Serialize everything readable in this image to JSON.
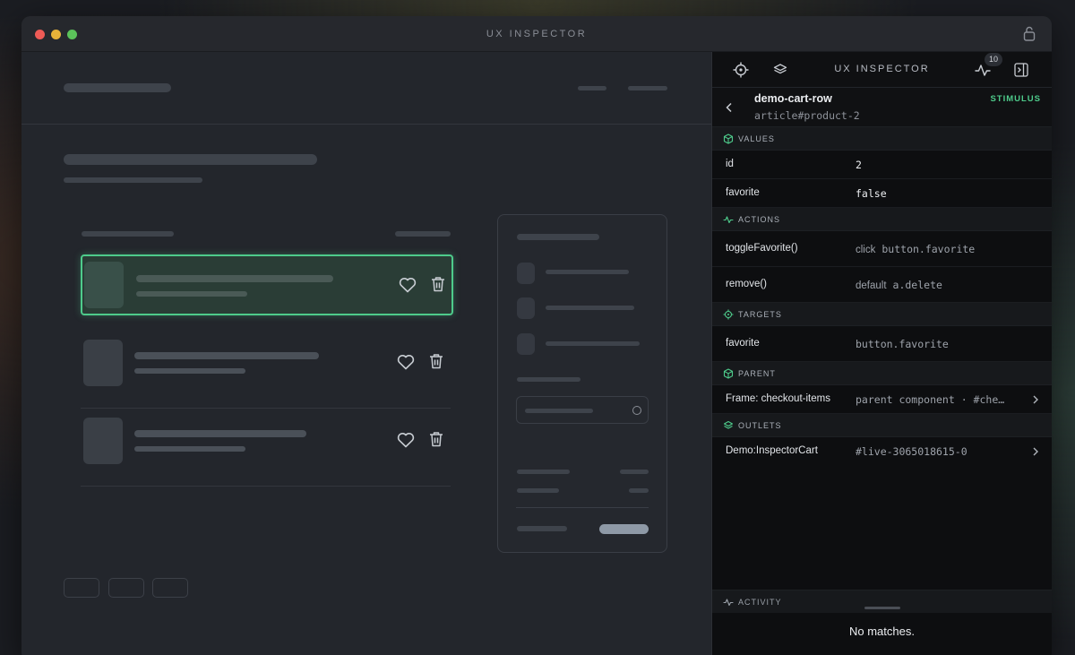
{
  "window": {
    "title": "UX INSPECTOR"
  },
  "inspector": {
    "title": "UX INSPECTOR",
    "activity_count": "10",
    "element": {
      "name": "demo-cart-row",
      "selector": "article#product-2",
      "kind": "STIMULUS"
    },
    "sections": {
      "values": "VALUES",
      "actions": "ACTIONS",
      "targets": "TARGETS",
      "parent": "PARENT",
      "outlets": "OUTLETS",
      "activity": "ACTIVITY"
    },
    "values": [
      {
        "key": "id",
        "value": "2"
      },
      {
        "key": "favorite",
        "value": "false"
      }
    ],
    "actions": [
      {
        "name": "toggleFavorite()",
        "event": "click",
        "target": "button.favorite"
      },
      {
        "name": "remove()",
        "event": "default",
        "target": "a.delete"
      }
    ],
    "targets": [
      {
        "name": "favorite",
        "value": "button.favorite"
      }
    ],
    "parent": {
      "name": "Frame: checkout-items",
      "value": "parent component · #che…"
    },
    "outlets": [
      {
        "name": "Demo:InspectorCart",
        "value": "#live-3065018615-0"
      }
    ],
    "empty_message": "No matches."
  },
  "colors": {
    "accent": "#4ecb8b"
  },
  "icons": [
    "lock-icon",
    "crosshair-icon",
    "layers-icon",
    "activity-icon",
    "sidebar-toggle-icon",
    "back-chevron-icon",
    "heart-icon",
    "trash-icon",
    "chevron-right-icon"
  ]
}
